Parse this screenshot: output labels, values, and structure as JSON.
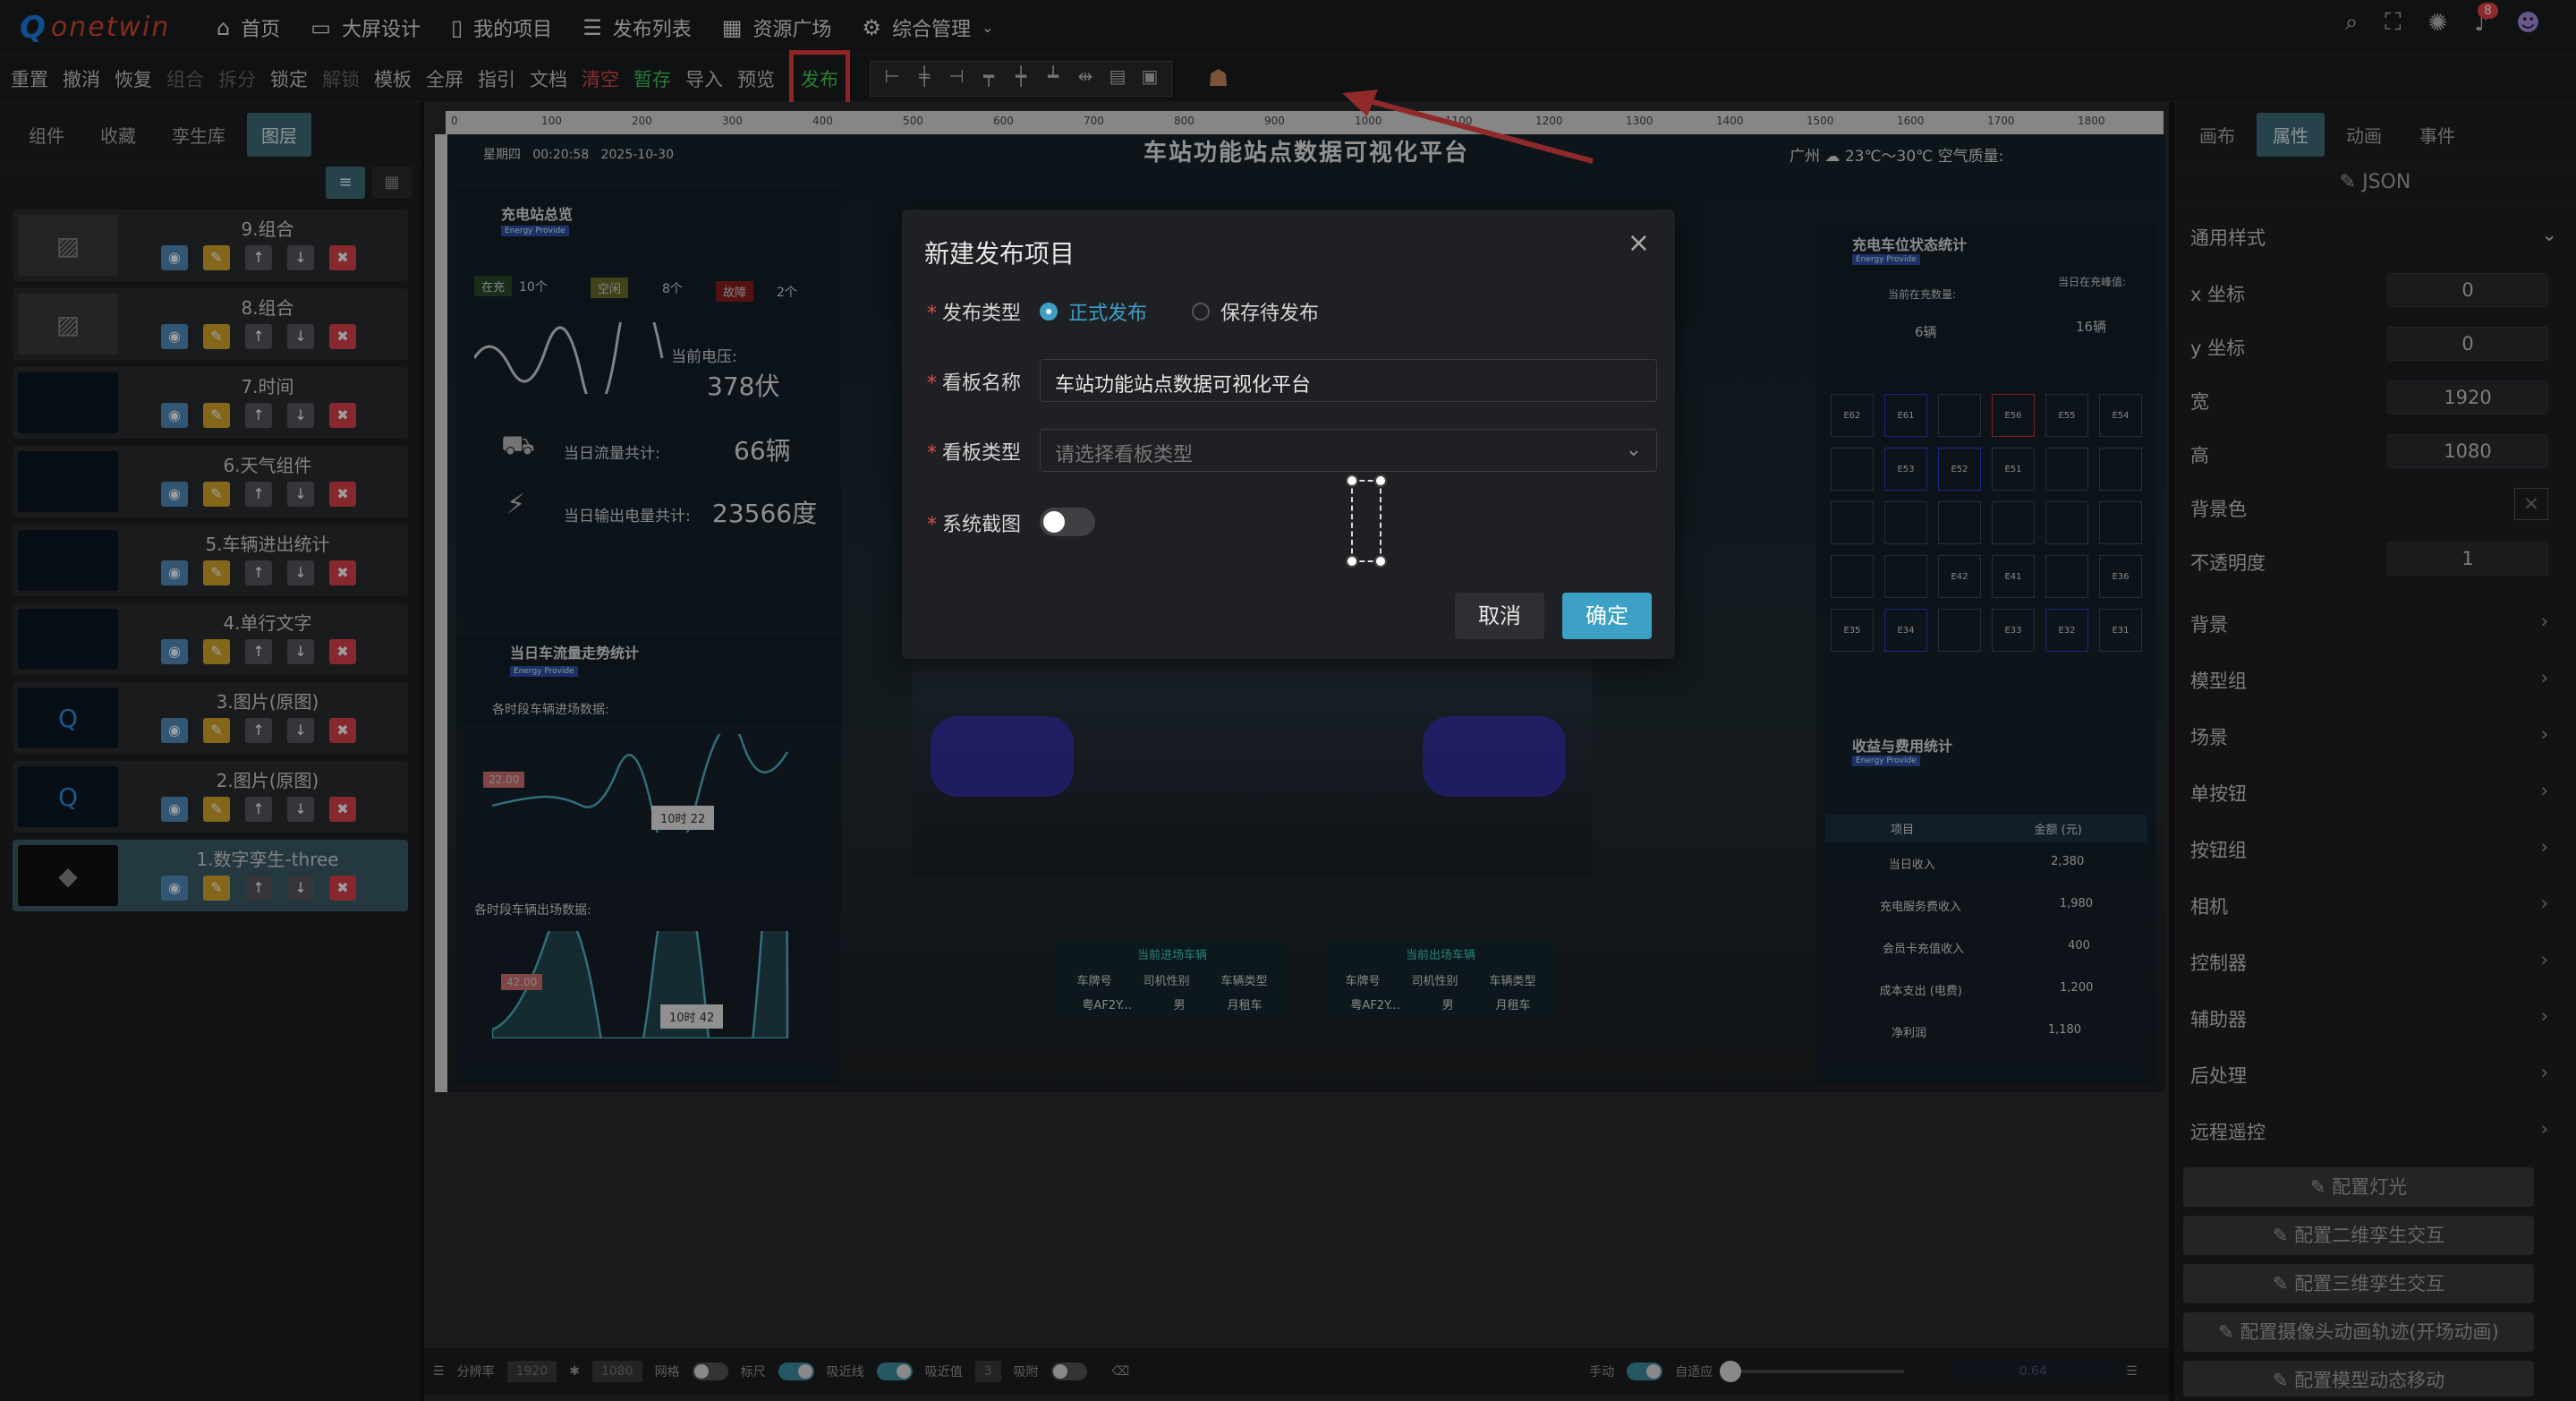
{
  "topnav": {
    "logo_text": "onetwin",
    "items": [
      {
        "icon": "home-icon",
        "label": "首页"
      },
      {
        "icon": "monitor-icon",
        "label": "大屏设计"
      },
      {
        "icon": "book-icon",
        "label": "我的项目"
      },
      {
        "icon": "list-icon",
        "label": "发布列表"
      },
      {
        "icon": "apps-icon",
        "label": "资源广场"
      },
      {
        "icon": "gear-icon",
        "label": "综合管理"
      }
    ],
    "notification_count": "8"
  },
  "toolbar": {
    "items": [
      {
        "label": "重置",
        "state": "normal"
      },
      {
        "label": "撤消",
        "state": "normal"
      },
      {
        "label": "恢复",
        "state": "normal"
      },
      {
        "label": "组合",
        "state": "dim"
      },
      {
        "label": "拆分",
        "state": "dim"
      },
      {
        "label": "锁定",
        "state": "normal"
      },
      {
        "label": "解锁",
        "state": "dim"
      },
      {
        "label": "模板",
        "state": "normal"
      },
      {
        "label": "全屏",
        "state": "normal"
      },
      {
        "label": "指引",
        "state": "normal"
      },
      {
        "label": "文档",
        "state": "normal"
      },
      {
        "label": "清空",
        "state": "red"
      },
      {
        "label": "暂存",
        "state": "green"
      },
      {
        "label": "导入",
        "state": "normal"
      },
      {
        "label": "预览",
        "state": "normal"
      }
    ],
    "publish_label": "发布"
  },
  "left": {
    "tabs": [
      "组件",
      "收藏",
      "孪生库",
      "图层"
    ],
    "active_tab": "图层",
    "layers": [
      {
        "name": "9.组合"
      },
      {
        "name": "8.组合"
      },
      {
        "name": "7.时间"
      },
      {
        "name": "6.天气组件"
      },
      {
        "name": "5.车辆进出统计"
      },
      {
        "name": "4.单行文字"
      },
      {
        "name": "3.图片(原图)"
      },
      {
        "name": "2.图片(原图)"
      },
      {
        "name": "1.数字孪生-three"
      }
    ]
  },
  "scene": {
    "title": "车站功能站点数据可视化平台",
    "weekday": "星期四",
    "time": "00:20:58",
    "date": "2025-10-30",
    "city": "广州",
    "weather": "23℃～30℃",
    "aqi_label": "空气质量:",
    "left_panel": {
      "title": "充电站总览",
      "tag": "Energy Provide",
      "status": [
        {
          "label": "在充",
          "count": "10个"
        },
        {
          "label": "空闲",
          "count": "8个"
        },
        {
          "label": "故障",
          "count": "2个"
        }
      ],
      "voltage_label": "当前电压:",
      "voltage_value": "378伏",
      "flow_label": "当日流量共计:",
      "flow_value": "66辆",
      "power_label": "当日输出电量共计:",
      "power_value": "23566度"
    },
    "trend_panel": {
      "title": "当日车流量走势统计",
      "tag": "Energy Provide",
      "in_label": "各时段车辆进场数据:",
      "out_label": "各时段车辆出场数据:",
      "in_tooltip_time": "10时",
      "in_tooltip_value": "22",
      "out_tooltip_time": "10时",
      "out_tooltip_value": "42",
      "in_max": "22.00",
      "out_max": "42.00"
    },
    "right_panel": {
      "title": "充电车位状态统计",
      "tag": "Energy Provide",
      "charging_label": "当前在充数量:",
      "charging_value": "6辆",
      "idle_label": "当日在充峰值:",
      "idle_value": "16辆",
      "slots": [
        "E62",
        "E61",
        "",
        "E56",
        "E55",
        "E54",
        "",
        "E53",
        "E52",
        "E51",
        "",
        "",
        "",
        "",
        "",
        "",
        "",
        "",
        "",
        "",
        "E42",
        "E41",
        "",
        "E36",
        "E35",
        "E34",
        "",
        "E33",
        "E32",
        "E31"
      ]
    },
    "revenue_panel": {
      "title": "收益与费用统计",
      "tag": "Energy Provide",
      "headers": [
        "项目",
        "金额 (元)"
      ],
      "rows": [
        [
          "当日收入",
          "2,380"
        ],
        [
          "充电服务费收入",
          "1,980"
        ],
        [
          "会员卡充值收入",
          "400"
        ],
        [
          "成本支出 (电费)",
          "1,200"
        ],
        [
          "净利润",
          "1,180"
        ]
      ]
    },
    "parking_tables": [
      {
        "title": "当前进场车辆",
        "headers": [
          "车牌号",
          "司机性别",
          "车辆类型"
        ],
        "row": [
          "粤AF2Y...",
          "男",
          "月租车"
        ]
      },
      {
        "title": "当前出场车辆",
        "headers": [
          "车牌号",
          "司机性别",
          "车辆类型"
        ],
        "row": [
          "粤AF2Y...",
          "男",
          "月租车"
        ]
      }
    ]
  },
  "bottombar": {
    "resolution_label": "分辨率",
    "width": "1920",
    "height": "1080",
    "grid_label": "网格",
    "ruler_label": "标尺",
    "snap_label": "吸近线",
    "snap_value_label": "吸近值",
    "snap_value": "3",
    "adsorb_label": "吸附",
    "manual_label": "手动",
    "adapt_label": "自适应",
    "zoom": "0.64"
  },
  "right": {
    "tabs": [
      "画布",
      "属性",
      "动画",
      "事件"
    ],
    "active_tab": "属性",
    "json_label": "JSON",
    "section": "通用样式",
    "props": [
      {
        "label": "x 坐标",
        "value": "0"
      },
      {
        "label": "y 坐标",
        "value": "0"
      },
      {
        "label": "宽",
        "value": "1920"
      },
      {
        "label": "高",
        "value": "1080"
      },
      {
        "label": "背景色",
        "value": ""
      },
      {
        "label": "不透明度",
        "value": "1"
      }
    ],
    "groups": [
      "背景",
      "模型组",
      "场景",
      "单按钮",
      "按钮组",
      "相机",
      "控制器",
      "辅助器",
      "后处理",
      "远程遥控"
    ],
    "config_buttons": [
      "配置灯光",
      "配置二维孪生交互",
      "配置三维孪生交互",
      "配置摄像头动画轨迹(开场动画)",
      "配置模型动态移动"
    ]
  },
  "modal": {
    "title": "新建发布项目",
    "type_label": "发布类型",
    "type_options": [
      "正式发布",
      "保存待发布"
    ],
    "type_selected": "正式发布",
    "name_label": "看板名称",
    "name_value": "车站功能站点数据可视化平台",
    "kind_label": "看板类型",
    "kind_placeholder": "请选择看板类型",
    "screenshot_label": "系统截图",
    "cancel_label": "取消",
    "ok_label": "确定"
  }
}
